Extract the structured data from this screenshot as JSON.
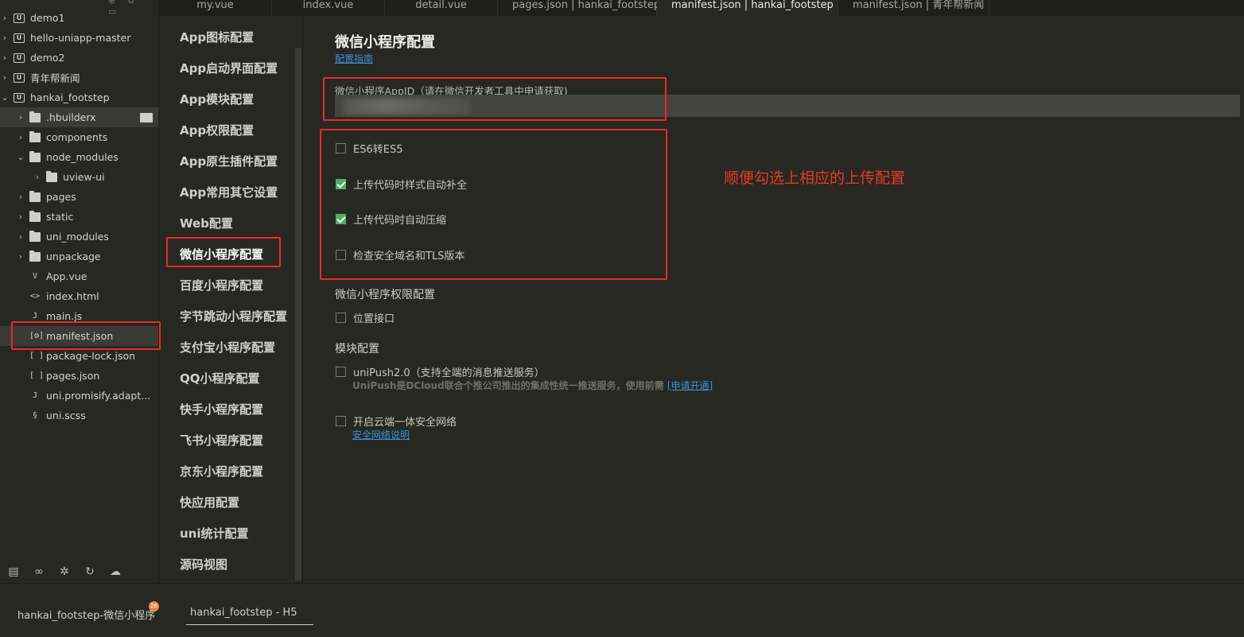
{
  "tabs": [
    {
      "label": "my.vue"
    },
    {
      "label": "index.vue"
    },
    {
      "label": "detail.vue"
    },
    {
      "label": "pages.json | hankai_footstep"
    },
    {
      "label": "manifest.json | hankai_footstep",
      "active": true
    },
    {
      "label": "manifest.json | 青年帮新闻"
    }
  ],
  "tree": {
    "items": [
      {
        "label": "demo1",
        "icon": "project-icon",
        "expanded": false
      },
      {
        "label": "hello-uniapp-master",
        "icon": "project-icon",
        "expanded": false
      },
      {
        "label": "demo2",
        "icon": "project-icon",
        "expanded": false
      },
      {
        "label": "青年帮新闻",
        "icon": "project-icon",
        "expanded": false
      },
      {
        "label": "hankai_footstep",
        "icon": "project-icon",
        "expanded": true
      },
      {
        "label": ".hbuilderx",
        "icon": "folder-icon",
        "expanded": false
      },
      {
        "label": "components",
        "icon": "folder-icon",
        "expanded": false
      },
      {
        "label": "node_modules",
        "icon": "folder-icon",
        "expanded": true
      },
      {
        "label": "uview-ui",
        "icon": "folder-icon",
        "expanded": false
      },
      {
        "label": "pages",
        "icon": "folder-icon",
        "expanded": false
      },
      {
        "label": "static",
        "icon": "folder-icon",
        "expanded": false
      },
      {
        "label": "uni_modules",
        "icon": "folder-icon",
        "expanded": false
      },
      {
        "label": "unpackage",
        "icon": "folder-icon",
        "expanded": false
      },
      {
        "label": "App.vue",
        "icon": "vue-file-icon"
      },
      {
        "label": "index.html",
        "icon": "html-file-icon"
      },
      {
        "label": "main.js",
        "icon": "js-file-icon"
      },
      {
        "label": "manifest.json",
        "icon": "manifest-file-icon"
      },
      {
        "label": "package-lock.json",
        "icon": "json-file-icon"
      },
      {
        "label": "pages.json",
        "icon": "json-file-icon"
      },
      {
        "label": "uni.promisify.adapt...",
        "icon": "js-file-icon"
      },
      {
        "label": "uni.scss",
        "icon": "scss-file-icon"
      }
    ],
    "bottom_icons": [
      "project-tree-icon",
      "binoculars-icon",
      "bug-icon",
      "git-icon",
      "cloud-icon"
    ]
  },
  "nav": {
    "items": [
      "App图标配置",
      "App启动界面配置",
      "App模块配置",
      "App权限配置",
      "App原生插件配置",
      "App常用其它设置",
      "Web配置",
      "微信小程序配置",
      "百度小程序配置",
      "字节跳动小程序配置",
      "支付宝小程序配置",
      "QQ小程序配置",
      "快手小程序配置",
      "飞书小程序配置",
      "京东小程序配置",
      "快应用配置",
      "uni统计配置",
      "源码视图"
    ],
    "selected": "微信小程序配置"
  },
  "main": {
    "title": "微信小程序配置",
    "guide_link": "配置指南",
    "appid_label": "微信小程序AppID（请在微信开发者工具中申请获取)",
    "appid_value": "",
    "upload_options": [
      {
        "label": "ES6转ES5",
        "checked": false
      },
      {
        "label": "上传代码时样式自动补全",
        "checked": true
      },
      {
        "label": "上传代码时自动压缩",
        "checked": true
      },
      {
        "label": "检查安全域名和TLS版本",
        "checked": false
      }
    ],
    "permission_title": "微信小程序权限配置",
    "permission_option": {
      "label": "位置接口",
      "checked": false
    },
    "module_title": "模块配置",
    "unipush": {
      "label": "uniPush2.0（支持全端的消息推送服务）",
      "checked": false,
      "desc": "UniPush是DCloud联合个推公司推出的集成性统一推送服务，使用前需",
      "link": "[申请开通]"
    },
    "secure_network": {
      "label": "开启云端一体安全网络",
      "checked": false,
      "link": "安全网络说明"
    },
    "annotation": "顺便勾选上相应的上传配置"
  },
  "bottom": {
    "run_tabs": [
      "hankai_footstep-微信小程序",
      "hankai_footstep - H5"
    ],
    "badge": "26",
    "active_run_tab": "hankai_footstep - H5"
  },
  "colors": {
    "background": "#272822",
    "highlight": "#ee2a24",
    "checkbox_checked": "#4cae62",
    "link": "#3d8fd8"
  }
}
